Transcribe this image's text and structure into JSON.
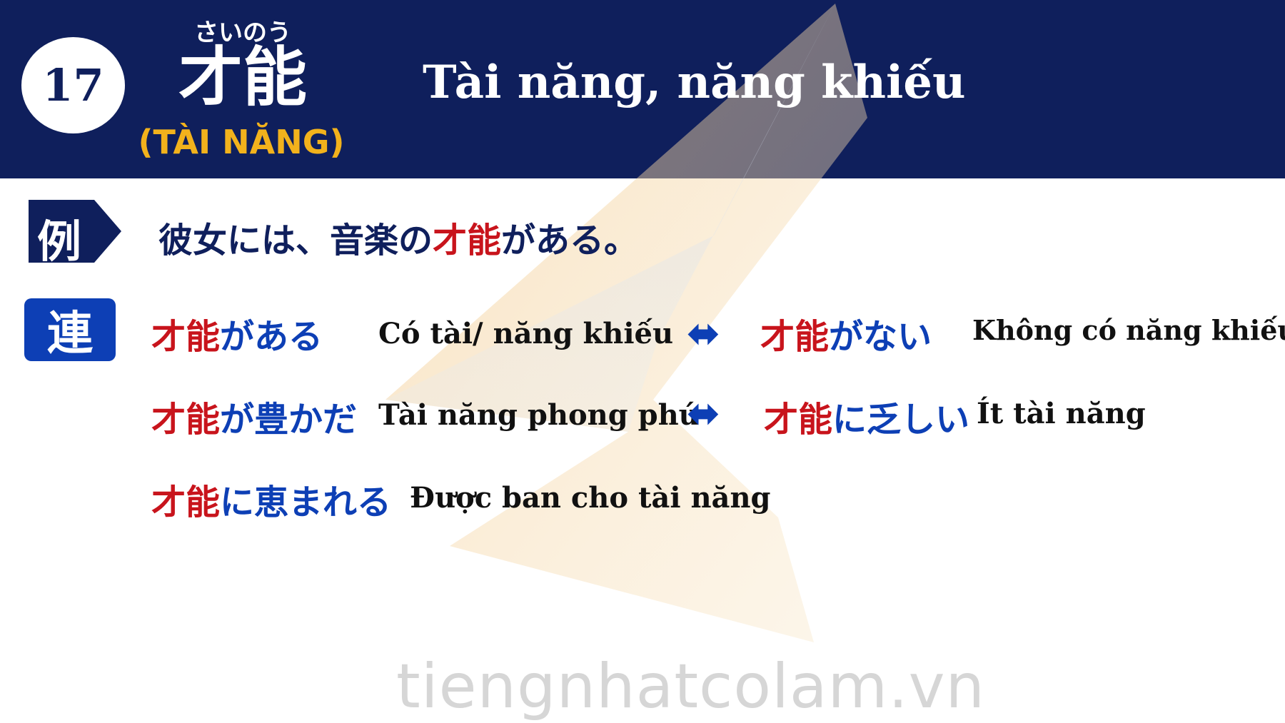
{
  "header": {
    "number": "17",
    "furigana": "さいのう",
    "kanji": "才能",
    "reading": "(TÀI NĂNG)",
    "meaning": "Tài năng, năng khiếu"
  },
  "example": {
    "tag": "例",
    "before": "彼女には、音楽の",
    "highlight": "才能",
    "after": "がある。"
  },
  "collocations": {
    "tag": "連",
    "rows": [
      {
        "kanji": "才能",
        "rest": "がある",
        "translation": "Có tài/ năng khiếu",
        "opposite_kanji": "才能",
        "opposite_rest": "がない",
        "opposite_translation": "Không có năng khiếu"
      },
      {
        "kanji": "才能",
        "rest": "が豊かだ",
        "translation": "Tài năng phong phú",
        "opposite_kanji": "才能",
        "opposite_rest": "に乏しい",
        "opposite_translation": "Ít tài năng"
      },
      {
        "kanji": "才能",
        "rest": "に恵まれる",
        "translation": "Được ban cho tài năng"
      }
    ]
  },
  "arrow_symbol": "⬌",
  "watermark": "tiengnhatcolam.vn",
  "colors": {
    "navy": "#0f1f5c",
    "red": "#c8141c",
    "blue": "#0d3fb5",
    "gold": "#f2b21c"
  }
}
